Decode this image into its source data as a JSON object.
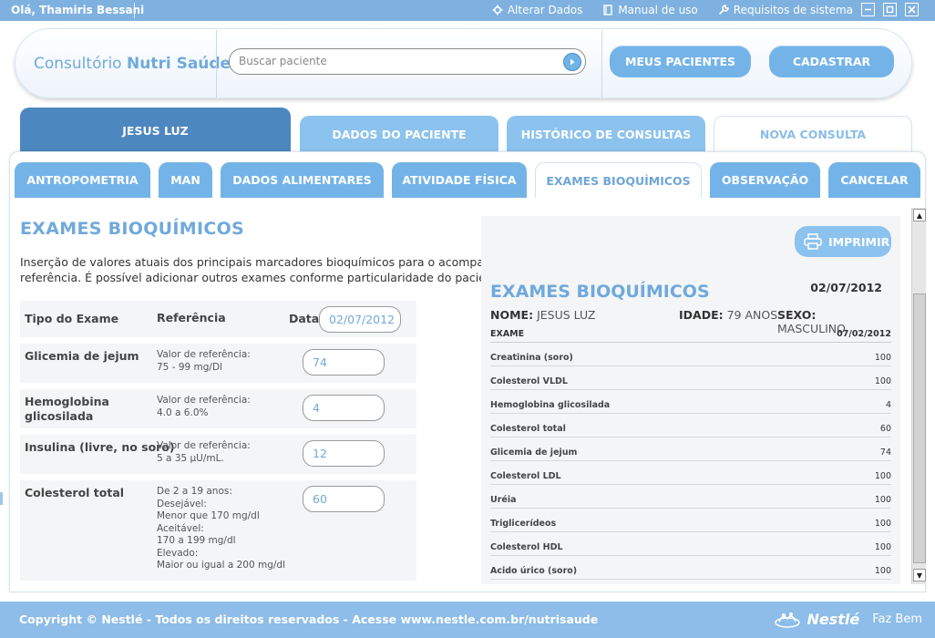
{
  "topbar": {
    "greeting": "Olá, Thamiris Bessani",
    "links": [
      {
        "label": "Alterar Dados",
        "icon": "gear-icon"
      },
      {
        "label": "Manual de uso",
        "icon": "book-icon"
      },
      {
        "label": "Requisitos de sistema",
        "icon": "wrench-icon"
      }
    ]
  },
  "header": {
    "logo_prefix": "Consultório ",
    "logo_brand": "Nutri Saúde",
    "search_placeholder": "Buscar paciente",
    "meus_pacientes": "MEUS PACIENTES",
    "cadastrar": "CADASTRAR"
  },
  "patient_tabs": {
    "name": "JESUS LUZ",
    "dados": "DADOS DO PACIENTE",
    "historico": "HISTÓRICO DE CONSULTAS",
    "nova": "NOVA CONSULTA"
  },
  "sub_tabs": {
    "antropometria": "ANTROPOMETRIA",
    "man": "MAN",
    "dados_alimentares": "DADOS ALIMENTARES",
    "atividade": "ATIVIDADE FÍSICA",
    "exames": "EXAMES BIOQUÍMICOS",
    "observacao": "OBSERVAÇÃO",
    "cancelar": "CANCELAR"
  },
  "main": {
    "title": "EXAMES BIOQUÍMICOS",
    "desc_line1": "Inserção de valores atuais dos principais marcadores bioquímicos para o acompanham",
    "desc_line2": "referência. É possível adicionar outros exames conforme particularidade do paciente.",
    "col_tipo": "Tipo do Exame",
    "col_ref": "Referência",
    "col_data": "Data",
    "date_value": "02/07/2012",
    "exams": [
      {
        "name": "Glicemia de jejum",
        "ref": "Valor de referência:\n75 - 99 mg/Dl",
        "value": "74"
      },
      {
        "name": "Hemoglobina\nglicosilada",
        "ref": "Valor de referência:\n4.0 a 6.0%",
        "value": "4"
      },
      {
        "name": "Insulina (livre, no soro)",
        "ref": "Valor de referência:\n5 a 35 µU/mL.",
        "value": "12"
      },
      {
        "name": "Colesterol total",
        "ref": "De 2 a 19 anos:\nDesejável:\nMenor que 170 mg/dl\nAceitável:\n170 a 199 mg/dl\nElevado:\nMaior ou igual a 200 mg/dl",
        "value": "60"
      }
    ]
  },
  "report": {
    "print_label": "IMPRIMIR",
    "title": "EXAMES BIOQUÍMICOS",
    "date": "02/07/2012",
    "nome_label": "NOME:",
    "nome_value": "JESUS LUZ",
    "idade_label": "IDADE:",
    "idade_value": "79 ANOS",
    "sexo_label": "SEXO:",
    "sexo_value": "MASCULINO",
    "col_exame": "EXAME",
    "col_date": "07/02/2012",
    "rows": [
      {
        "name": "Creatinina (soro)",
        "value": "100"
      },
      {
        "name": "Colesterol VLDL",
        "value": "100"
      },
      {
        "name": "Hemoglobina glicosilada",
        "value": "4"
      },
      {
        "name": "Colesterol total",
        "value": "60"
      },
      {
        "name": "Glicemia de jejum",
        "value": "74"
      },
      {
        "name": "Colesterol LDL",
        "value": "100"
      },
      {
        "name": "Uréia",
        "value": "100"
      },
      {
        "name": "Triglicerídeos",
        "value": "100"
      },
      {
        "name": "Colesterol HDL",
        "value": "100"
      },
      {
        "name": "Acido úrico (soro)",
        "value": "100"
      }
    ]
  },
  "footer": {
    "copyright": "Copyright © Nestlé - Todos os direitos reservados - Acesse www.nestle.com.br/nutrisaude",
    "brand": "Nestlé",
    "tagline": "Faz Bem"
  },
  "colors": {
    "accent": "#74b3e7",
    "dark_tab": "#4d87bf",
    "title": "#6fa9dc"
  }
}
